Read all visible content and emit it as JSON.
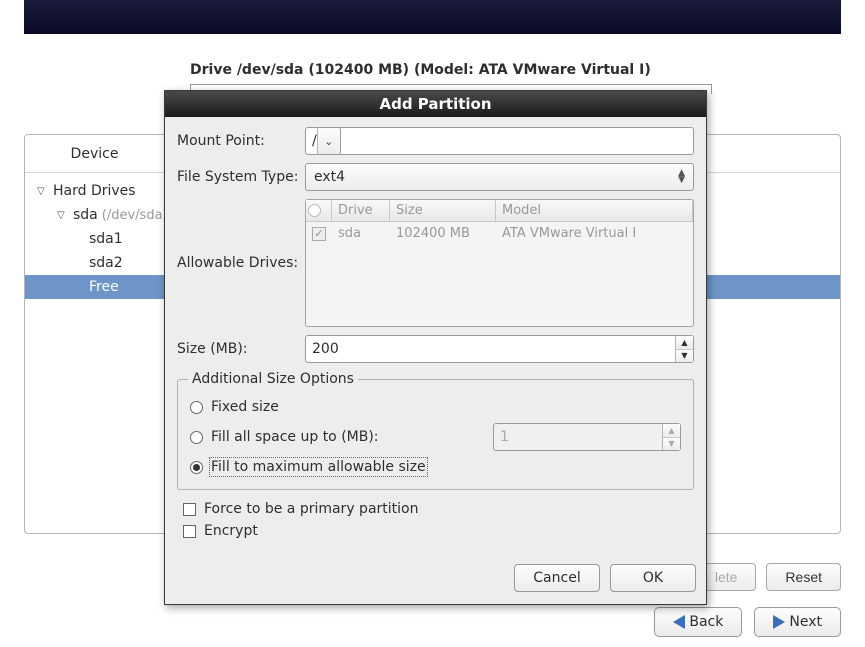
{
  "drive_header": "Drive /dev/sda (102400 MB) (Model: ATA VMware Virtual I)",
  "columns": {
    "device": "Device"
  },
  "tree": {
    "root": "Hard Drives",
    "disk": "sda",
    "disk_path": "(/dev/sda)",
    "p1": "sda1",
    "p2": "sda2",
    "free": "Free"
  },
  "dialog": {
    "title": "Add Partition",
    "labels": {
      "mount_point": "Mount Point:",
      "fs_type": "File System Type:",
      "allowable": "Allowable Drives:",
      "size": "Size (MB):",
      "additional": "Additional Size Options",
      "fixed": "Fixed size",
      "fill_up_to": "Fill all space up to (MB):",
      "fill_max": "Fill to maximum allowable size",
      "force_primary": "Force to be a primary partition",
      "encrypt": "Encrypt"
    },
    "values": {
      "mount_point": "/",
      "fs_type": "ext4",
      "size": "200",
      "fill_up_to": "1"
    },
    "drives_table": {
      "headers": {
        "drive": "Drive",
        "size": "Size",
        "model": "Model"
      },
      "row": {
        "drive": "sda",
        "size": "102400 MB",
        "model": "ATA VMware Virtual I"
      }
    },
    "buttons": {
      "cancel": "Cancel",
      "ok": "OK"
    }
  },
  "toolbar": {
    "delete": "lete",
    "reset": "Reset"
  },
  "nav": {
    "back": "Back",
    "next": "Next"
  }
}
